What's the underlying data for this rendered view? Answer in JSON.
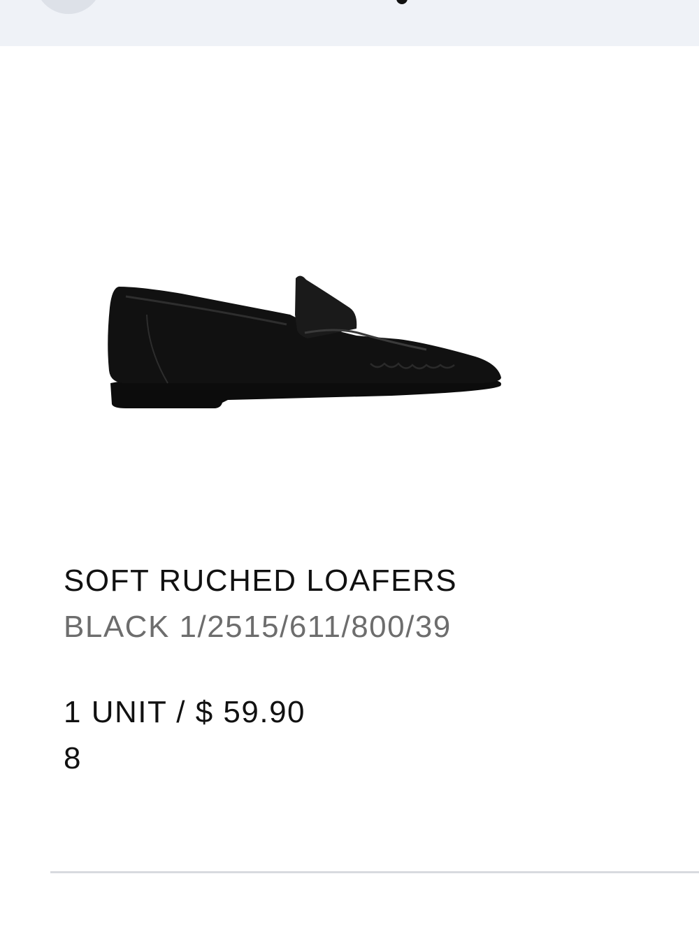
{
  "product": {
    "name": "SOFT RUCHED LOAFERS",
    "variant": "BLACK 1/2515/611/800/39",
    "price_line": "1 UNIT / $ 59.90",
    "size": "8"
  },
  "image": {
    "depicts": "black-leather-penny-loafer-shoe-icon"
  },
  "colors": {
    "header_bg": "#eff2f7",
    "primary_text": "#111111",
    "secondary_text": "#6d6d6d",
    "divider": "#d8dadf"
  }
}
